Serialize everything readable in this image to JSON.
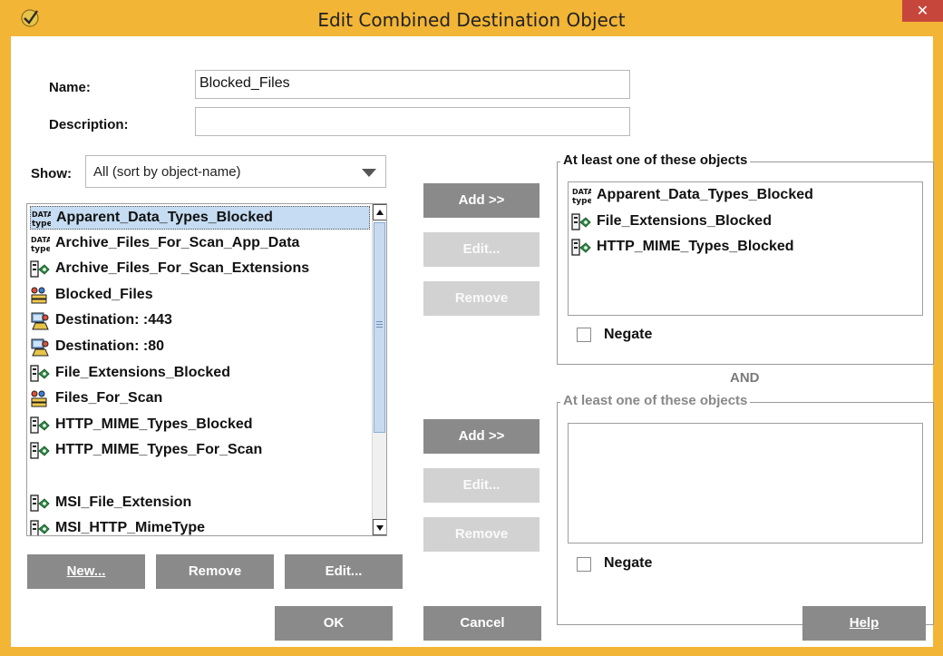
{
  "window": {
    "title": "Edit Combined Destination Object",
    "close_glyph": "✕"
  },
  "form": {
    "name_label": "Name:",
    "name_value": "Blocked_Files",
    "description_label": "Description:",
    "description_value": ""
  },
  "show": {
    "label": "Show:",
    "selected": "All (sort by object-name)"
  },
  "objects": [
    {
      "label": "Apparent_Data_Types_Blocked",
      "icon": "data-type-icon",
      "selected": true
    },
    {
      "label": "Archive_Files_For_Scan_App_Data",
      "icon": "data-type-icon"
    },
    {
      "label": "Archive_Files_For_Scan_Extensions",
      "icon": "file-extension-icon"
    },
    {
      "label": "Blocked_Files",
      "icon": "combined-object-icon"
    },
    {
      "label": "Destination: :443",
      "icon": "destination-icon"
    },
    {
      "label": "Destination: :80",
      "icon": "destination-icon"
    },
    {
      "label": "File_Extensions_Blocked",
      "icon": "file-extension-icon"
    },
    {
      "label": "Files_For_Scan",
      "icon": "combined-object-icon"
    },
    {
      "label": "HTTP_MIME_Types_Blocked",
      "icon": "file-extension-icon"
    },
    {
      "label": "HTTP_MIME_Types_For_Scan",
      "icon": "file-extension-icon"
    },
    {
      "label": "",
      "icon": ""
    },
    {
      "label": "MSI_File_Extension",
      "icon": "file-extension-icon"
    },
    {
      "label": "MSI_HTTP_MimeType",
      "icon": "file-extension-icon"
    }
  ],
  "left_buttons": {
    "new": "New...",
    "remove": "Remove",
    "edit": "Edit..."
  },
  "mid_buttons_1": {
    "add": "Add >>",
    "edit": "Edit...",
    "remove": "Remove"
  },
  "mid_buttons_2": {
    "add": "Add >>",
    "edit": "Edit...",
    "remove": "Remove"
  },
  "group1": {
    "title": "At least one of these objects",
    "items": [
      {
        "label": "Apparent_Data_Types_Blocked",
        "icon": "data-type-icon"
      },
      {
        "label": "File_Extensions_Blocked",
        "icon": "file-extension-icon"
      },
      {
        "label": "HTTP_MIME_Types_Blocked",
        "icon": "file-extension-icon"
      }
    ],
    "negate": "Negate",
    "negate_checked": false
  },
  "and_label": "AND",
  "group2": {
    "title": "At least one of these objects",
    "items": [],
    "negate": "Negate",
    "negate_checked": false
  },
  "footer": {
    "ok": "OK",
    "cancel": "Cancel",
    "help": "Help"
  },
  "colors": {
    "frame": "#f2b535",
    "close": "#c7463b",
    "button": "#8a8a8a",
    "button_disabled": "#d2d2d2",
    "selection": "#c5dcf2"
  }
}
